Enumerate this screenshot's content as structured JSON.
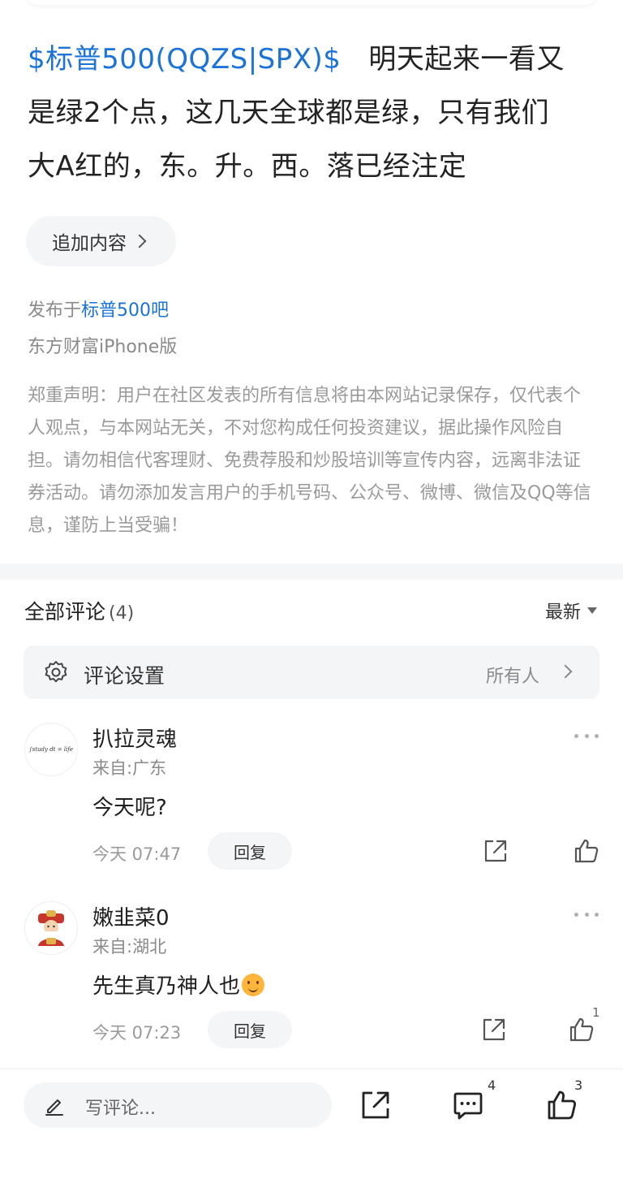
{
  "post": {
    "stock_tag": "$标普500(QQZS|SPX)$",
    "text_line1_tail": "明天起来一看又",
    "text_line2": "是绿2个点，这几天全球都是绿，只有我们",
    "text_line3": "大A红的，东。升。西。落已经注定",
    "add_content_label": "追加内容",
    "published_prefix": "发布于",
    "forum_name": "标普500吧",
    "device": "东方财富iPhone版",
    "disclaimer": "郑重声明：用户在社区发表的所有信息将由本网站记录保存，仅代表个人观点，与本网站无关，不对您构成任何投资建议，据此操作风险自担。请勿相信代客理财、免费荐股和炒股培训等宣传内容，远离非法证券活动。请勿添加发言用户的手机号码、公众号、微博、微信及QQ等信息，谨防上当受骗！"
  },
  "comments_section": {
    "title": "全部评论",
    "count": "(4)",
    "sort_label": "最新",
    "settings_label": "评论设置",
    "settings_value": "所有人"
  },
  "comments": [
    {
      "username": "扒拉灵魂",
      "location": "来自:广东",
      "text": "今天呢?",
      "time": "今天 07:47",
      "reply_label": "回复",
      "likes": "",
      "avatar_text": "∫study dt = life"
    },
    {
      "username": "嫩韭菜0",
      "location": "来自:湖北",
      "text": "先生真乃神人也",
      "emoji": "smile-emoji",
      "time": "今天 07:23",
      "reply_label": "回复",
      "likes": "1"
    }
  ],
  "bottom_bar": {
    "write_placeholder": "写评论...",
    "comment_count": "4",
    "like_count": "3"
  },
  "colors": {
    "link": "#1a73d9",
    "muted": "#8a8a8a",
    "panel": "#f4f5f7"
  }
}
